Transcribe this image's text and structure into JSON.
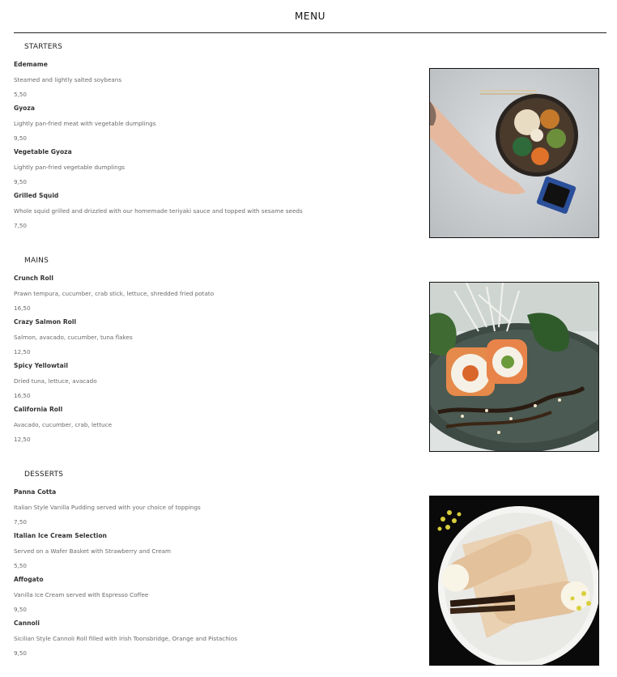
{
  "menu": {
    "title": "MENU",
    "sections": [
      {
        "heading": "STARTERS",
        "photo_icon": "poke-bowl-photo",
        "items": [
          {
            "name": "Edemame",
            "description": "Steamed and lightly salted soybeans",
            "price": "5,50"
          },
          {
            "name": "Gyoza",
            "description": "Lightly pan-fried meat with vegetable dumplings",
            "price": "9,50"
          },
          {
            "name": "Vegetable Gyoza",
            "description": "Lightly pan-fried vegetable dumplings",
            "price": "9,50"
          },
          {
            "name": "Grilled Squid",
            "description": "Whole squid grilled and drizzled with our homemade teriyaki sauce and topped with sesame seeds",
            "price": "7,50"
          }
        ]
      },
      {
        "heading": "MAINS",
        "photo_icon": "sushi-rolls-photo",
        "items": [
          {
            "name": "Crunch Roll",
            "description": "Prawn tempura, cucumber, crab stick, lettuce, shredded fried potato",
            "price": "16,50"
          },
          {
            "name": "Crazy Salmon Roll",
            "description": "Salmon, avacado, cucumber, tuna flakes",
            "price": "12,50"
          },
          {
            "name": "Spicy Yellowtail",
            "description": "Dried tuna, lettuce, avacado",
            "price": "16,50"
          },
          {
            "name": "California Roll",
            "description": "Avacado, cucumber, crab, lettuce",
            "price": "12,50"
          }
        ]
      },
      {
        "heading": "DESSERTS",
        "photo_icon": "cannoli-photo",
        "items": [
          {
            "name": "Panna Cotta",
            "description": "Italian Style Vanilla Pudding served with your choice of toppings",
            "price": "7,50"
          },
          {
            "name": "Italian Ice Cream Selection",
            "description": "Served on a Wafer Basket with Strawberry and Cream",
            "price": "5,50"
          },
          {
            "name": "Affogato",
            "description": "Vanilla Ice Cream served with Espresso Coffee",
            "price": "9,50"
          },
          {
            "name": "Cannoli",
            "description": "Sicilian Style Cannoli Roll filled with Irish Toonsbridge, Orange and Pistachios",
            "price": "9,50"
          }
        ]
      }
    ]
  }
}
